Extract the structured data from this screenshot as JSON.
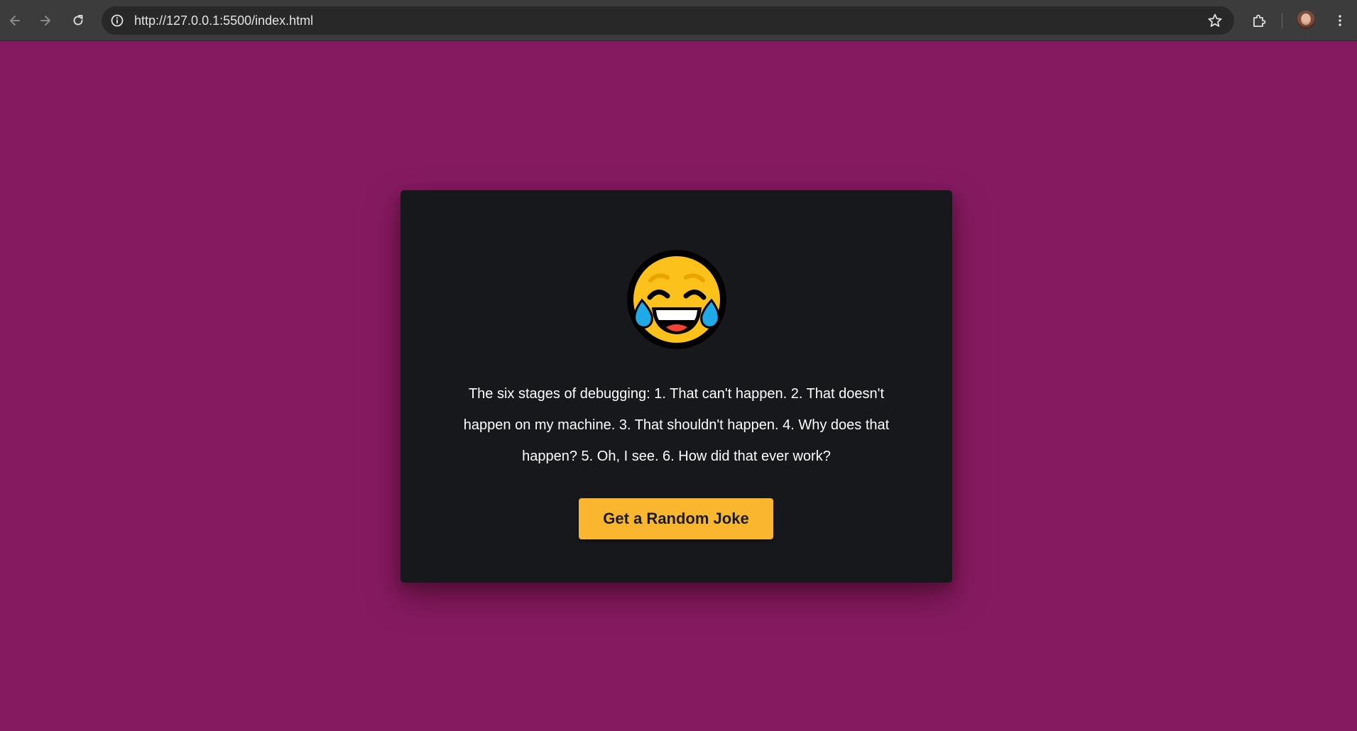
{
  "browser": {
    "url": "http://127.0.0.1:5500/index.html",
    "icons": {
      "back": "arrow-left-icon",
      "forward": "arrow-right-icon",
      "reload": "reload-icon",
      "site_info": "info-icon",
      "bookmark": "star-icon",
      "extensions": "puzzle-icon",
      "menu": "kebab-menu-icon"
    }
  },
  "page": {
    "background_color": "#861a61",
    "card_color": "#16181c",
    "emoji": "face-with-tears-of-joy-icon",
    "joke": "The six stages of debugging: 1. That can't happen. 2. That doesn't happen on my machine. 3. That shouldn't happen. 4. Why does that happen? 5. Oh, I see. 6. How did that ever work?",
    "button_label": "Get a Random Joke",
    "button_color": "#fbb62f"
  }
}
